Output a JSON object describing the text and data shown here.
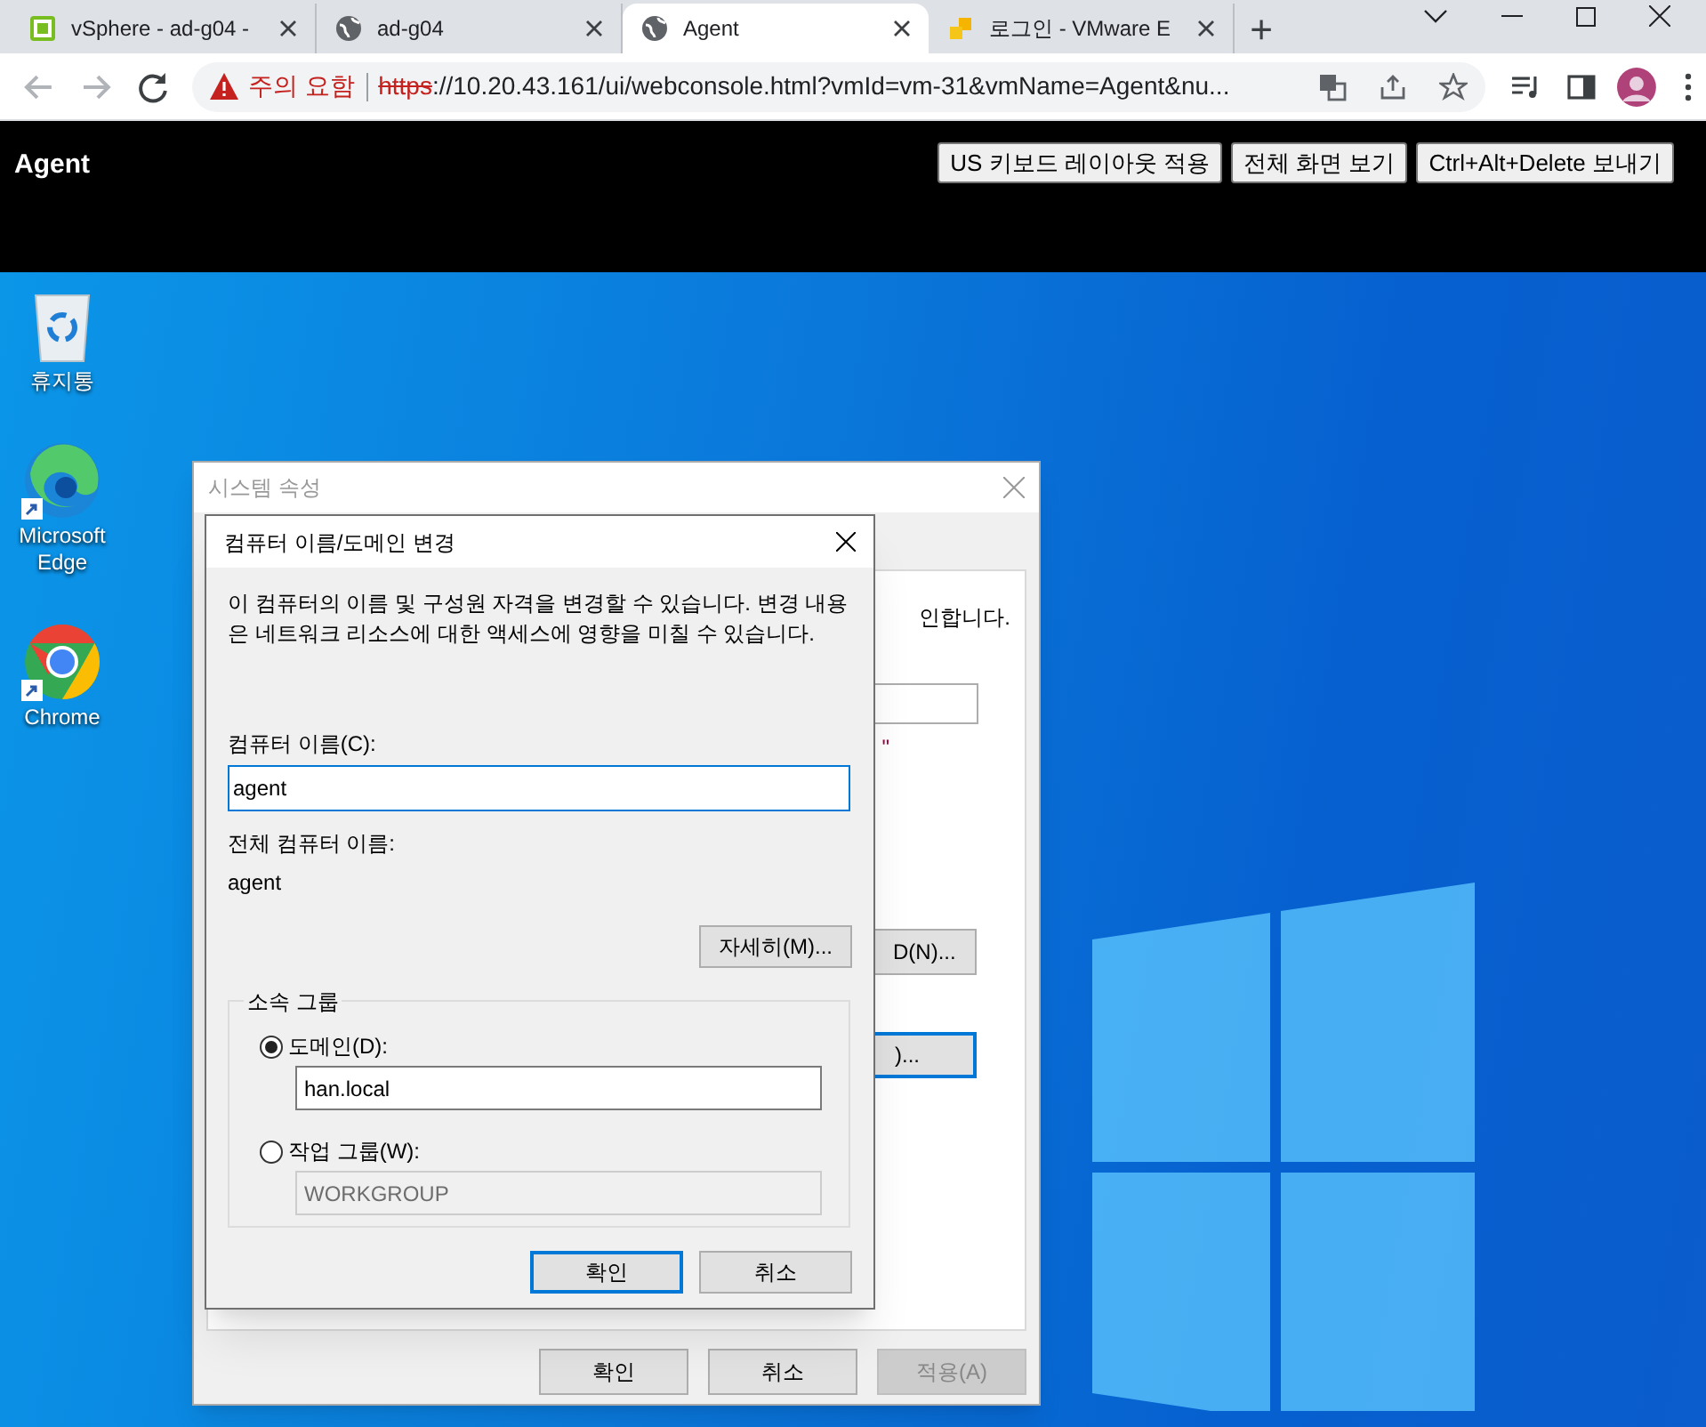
{
  "browser": {
    "tabs": [
      {
        "title": "vSphere - ad-g04 -",
        "kind": "vsphere",
        "selected": false
      },
      {
        "title": "ad-g04",
        "kind": "globe",
        "selected": false
      },
      {
        "title": "Agent",
        "kind": "globe",
        "selected": true
      },
      {
        "title": "로그인 - VMware E",
        "kind": "vmware",
        "selected": false
      }
    ],
    "new_tab": "+",
    "address": {
      "warning": "주의 요함",
      "scheme": "https",
      "rest": "://10.20.43.161/ui/webconsole.html?vmId=vm-31&vmName=Agent&nu..."
    }
  },
  "console": {
    "title": "Agent",
    "buttons": [
      "US 키보드 레이아웃 적용",
      "전체 화면 보기",
      "Ctrl+Alt+Delete 보내기"
    ]
  },
  "desktop_icons": [
    {
      "label": "휴지통",
      "kind": "recycle-bin",
      "shortcut": false
    },
    {
      "label": "Microsoft Edge",
      "kind": "edge",
      "shortcut": true
    },
    {
      "label": "Chrome",
      "kind": "chrome",
      "shortcut": true
    }
  ],
  "system_properties": {
    "title": "시스템 속성",
    "partial_text": "인합니다.",
    "partial_mark": "\"",
    "partial_buttons": [
      {
        "label": "D(N)...",
        "focused": false
      },
      {
        "label": ")...",
        "focused": true
      }
    ],
    "buttons": [
      {
        "label": "확인",
        "disabled": false
      },
      {
        "label": "취소",
        "disabled": false
      },
      {
        "label": "적용(A)",
        "disabled": true
      }
    ]
  },
  "change_dialog": {
    "title": "컴퓨터 이름/도메인 변경",
    "description": "이 컴퓨터의 이름 및 구성원 자격을 변경할 수 있습니다. 변경 내용은 네트워크 리소스에 대한 액세스에 영향을 미칠 수 있습니다.",
    "computer_name": {
      "label": "컴퓨터 이름(C):",
      "value": "agent"
    },
    "full_name": {
      "label": "전체 컴퓨터 이름:",
      "value": "agent"
    },
    "more_button": "자세히(M)...",
    "member_of": {
      "label": "소속 그룹",
      "options": [
        {
          "label": "도메인(D):",
          "value": "han.local",
          "selected": true
        },
        {
          "label": "작업 그룹(W):",
          "value": "WORKGROUP",
          "selected": false
        }
      ]
    },
    "buttons": [
      {
        "label": "확인",
        "default": true
      },
      {
        "label": "취소",
        "default": false
      }
    ]
  }
}
